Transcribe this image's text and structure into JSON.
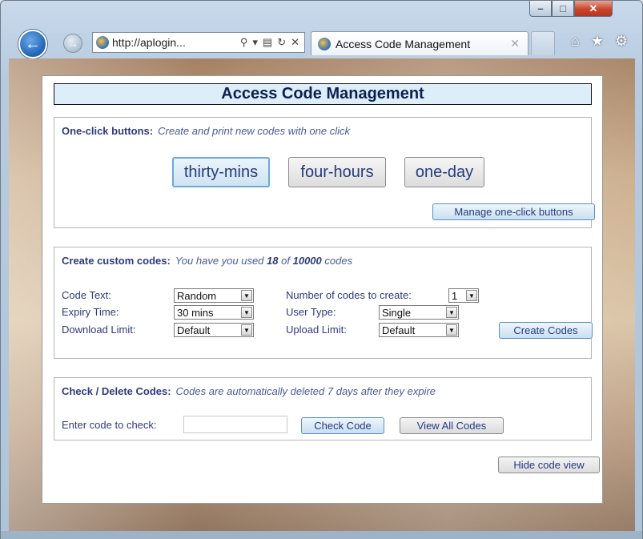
{
  "browser": {
    "address": "http://aplogin...",
    "address_tools": [
      "search-icon",
      "dropdown-icon",
      "compat-icon",
      "refresh-icon",
      "stop-icon"
    ],
    "tab_title": "Access Code Management",
    "window_buttons": {
      "minimize": "–",
      "maximize": "□",
      "close": "✕"
    }
  },
  "page": {
    "title": "Access Code Management",
    "one_click": {
      "title": "One-click buttons:",
      "subtitle": "Create and print new codes with one click",
      "buttons": [
        "thirty-mins",
        "four-hours",
        "one-day"
      ],
      "manage_label": "Manage one-click buttons"
    },
    "custom": {
      "title": "Create custom codes:",
      "subtitle_prefix": "You have you used",
      "used": "18",
      "subtitle_mid": "of",
      "total": "10000",
      "subtitle_suffix": "codes",
      "code_text_label": "Code Text:",
      "code_text_value": "Random",
      "expiry_label": "Expiry Time:",
      "expiry_value": "30 mins",
      "download_label": "Download Limit:",
      "download_value": "Default",
      "num_codes_label": "Number of codes to create:",
      "num_codes_value": "1",
      "user_type_label": "User Type:",
      "user_type_value": "Single",
      "upload_label": "Upload Limit:",
      "upload_value": "Default",
      "create_label": "Create Codes"
    },
    "check": {
      "title": "Check / Delete Codes:",
      "subtitle": "Codes are automatically deleted 7 days after they expire",
      "enter_label": "Enter code to check:",
      "input_value": "",
      "check_label": "Check Code",
      "view_all_label": "View All Codes"
    },
    "hide_view_label": "Hide code view"
  }
}
